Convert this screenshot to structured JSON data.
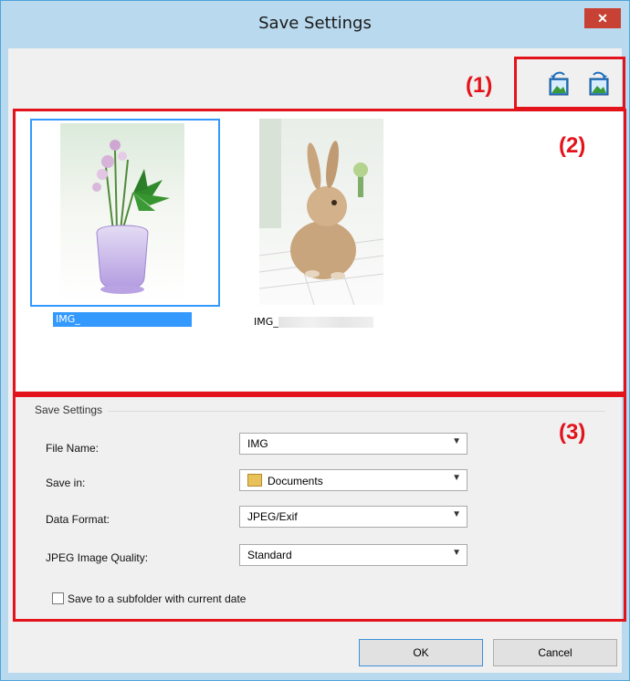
{
  "window": {
    "title": "Save Settings",
    "close_glyph": "✕"
  },
  "callouts": {
    "c1": "(1)",
    "c2": "(2)",
    "c3": "(3)"
  },
  "toolbar": {
    "icons": [
      "rotate-left-icon",
      "rotate-right-icon"
    ]
  },
  "thumbnails": [
    {
      "caption": "IMG_",
      "selected": true,
      "subject": "flowers-in-vase"
    },
    {
      "caption": "IMG_",
      "selected": false,
      "subject": "rabbit"
    }
  ],
  "settings": {
    "group_label": "Save Settings",
    "file_name": {
      "label": "File Name:",
      "value": "IMG"
    },
    "save_in": {
      "label": "Save in:",
      "value": "Documents"
    },
    "data_format": {
      "label": "Data Format:",
      "value": "JPEG/Exif"
    },
    "jpeg_quality": {
      "label": "JPEG Image Quality:",
      "value": "Standard"
    },
    "subfolder": {
      "label": "Save to a subfolder with current date",
      "checked": false
    }
  },
  "buttons": {
    "ok": "OK",
    "cancel": "Cancel"
  },
  "colors": {
    "callout": "#e3131b",
    "selection": "#3399ff",
    "titlebar": "#b9d9ee"
  }
}
